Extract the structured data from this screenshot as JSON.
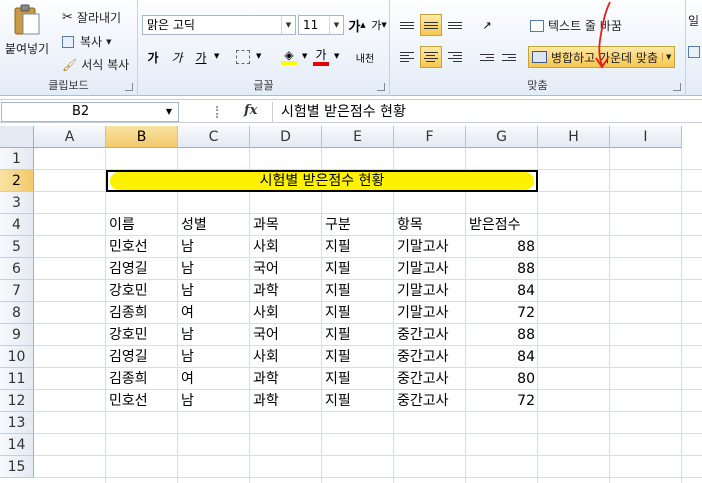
{
  "ribbon": {
    "clipboard": {
      "paste": "붙여넣기",
      "cut": "잘라내기",
      "copy": "복사",
      "format_painter": "서식 복사",
      "label": "클립보드"
    },
    "font": {
      "name": "맑은 고딕",
      "size": "11",
      "bold": "가",
      "italic": "가",
      "underline": "가",
      "grow": "가",
      "shrink": "가",
      "color_a": "가",
      "phonetic": "내천",
      "label": "글꼴",
      "fill_color": "#ffff00",
      "font_color": "#e00000"
    },
    "align": {
      "wrap": "텍스트 줄 바꿈",
      "merge": "병합하고 가운데 맞춤",
      "label": "맞춤"
    },
    "cut_off": "일"
  },
  "formula_bar": {
    "name_box": "B2",
    "fx": "fx",
    "content": "시험별 받은점수 현황"
  },
  "sheet": {
    "columns": [
      "A",
      "B",
      "C",
      "D",
      "E",
      "F",
      "G",
      "H",
      "I"
    ],
    "rows": [
      "1",
      "2",
      "3",
      "4",
      "5",
      "6",
      "7",
      "8",
      "9",
      "10",
      "11",
      "12",
      "13",
      "14",
      "15"
    ],
    "title": "시험별 받은점수 현황",
    "headers": [
      "이름",
      "성별",
      "과목",
      "구분",
      "항목",
      "받은점수"
    ],
    "data": [
      [
        "민호선",
        "남",
        "사회",
        "지필",
        "기말고사",
        "88"
      ],
      [
        "김영길",
        "남",
        "국어",
        "지필",
        "기말고사",
        "88"
      ],
      [
        "강호민",
        "남",
        "과학",
        "지필",
        "기말고사",
        "84"
      ],
      [
        "김종희",
        "여",
        "사회",
        "지필",
        "기말고사",
        "72"
      ],
      [
        "강호민",
        "남",
        "국어",
        "지필",
        "중간고사",
        "88"
      ],
      [
        "김영길",
        "남",
        "사회",
        "지필",
        "중간고사",
        "84"
      ],
      [
        "김종희",
        "여",
        "과학",
        "지필",
        "중간고사",
        "80"
      ],
      [
        "민호선",
        "남",
        "과학",
        "지필",
        "중간고사",
        "72"
      ]
    ],
    "highlight_color": "#fff200"
  }
}
